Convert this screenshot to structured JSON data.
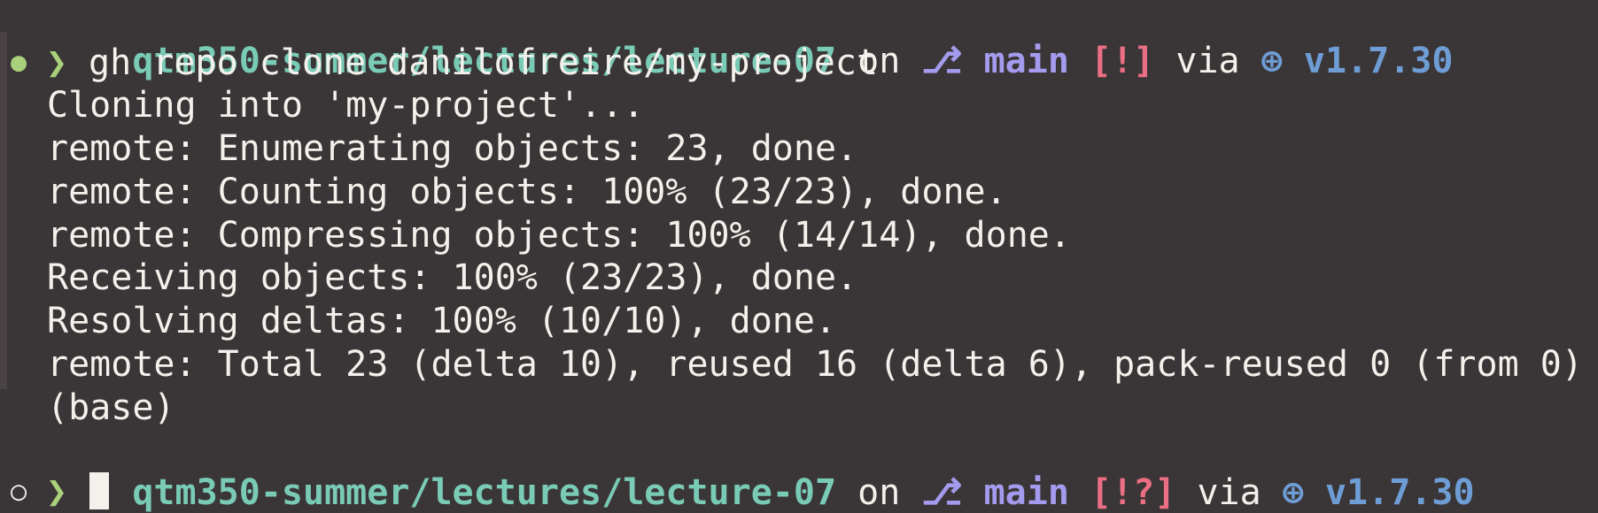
{
  "prompt_top": {
    "path": "qtm350-summer/lectures/lecture-07",
    "on_word": "on",
    "branch_icon": "⎇",
    "branch": "main",
    "status": "[!]",
    "via_word": "via",
    "env_icon": "⊕",
    "version": "v1.7.30"
  },
  "command": {
    "marker": "●",
    "prompt_char": "❯",
    "text": "gh repo clone danilofreire/my-project"
  },
  "output_lines": [
    "Cloning into 'my-project'...",
    "remote: Enumerating objects: 23, done.",
    "remote: Counting objects: 100% (23/23), done.",
    "remote: Compressing objects: 100% (14/14), done.",
    "Receiving objects: 100% (23/23), done.",
    "Resolving deltas: 100% (10/10), done.",
    "remote: Total 23 (delta 10), reused 16 (delta 6), pack-reused 0 (from 0)",
    "(base)"
  ],
  "prompt_bottom": {
    "path": "qtm350-summer/lectures/lecture-07",
    "on_word": "on",
    "branch_icon": "⎇",
    "branch": "main",
    "status": "[!?]",
    "via_word": "via",
    "env_icon": "⊕",
    "version": "v1.7.30"
  },
  "input_prompt": {
    "marker": "○",
    "prompt_char": "❯",
    "text": ""
  },
  "colors": {
    "background": "#3a3536",
    "path": "#79cbb6",
    "branch": "#a59bee",
    "status": "#ea6f84",
    "version": "#6e9dd5",
    "prompt": "#a9d07a",
    "text": "#f3f1ec"
  }
}
